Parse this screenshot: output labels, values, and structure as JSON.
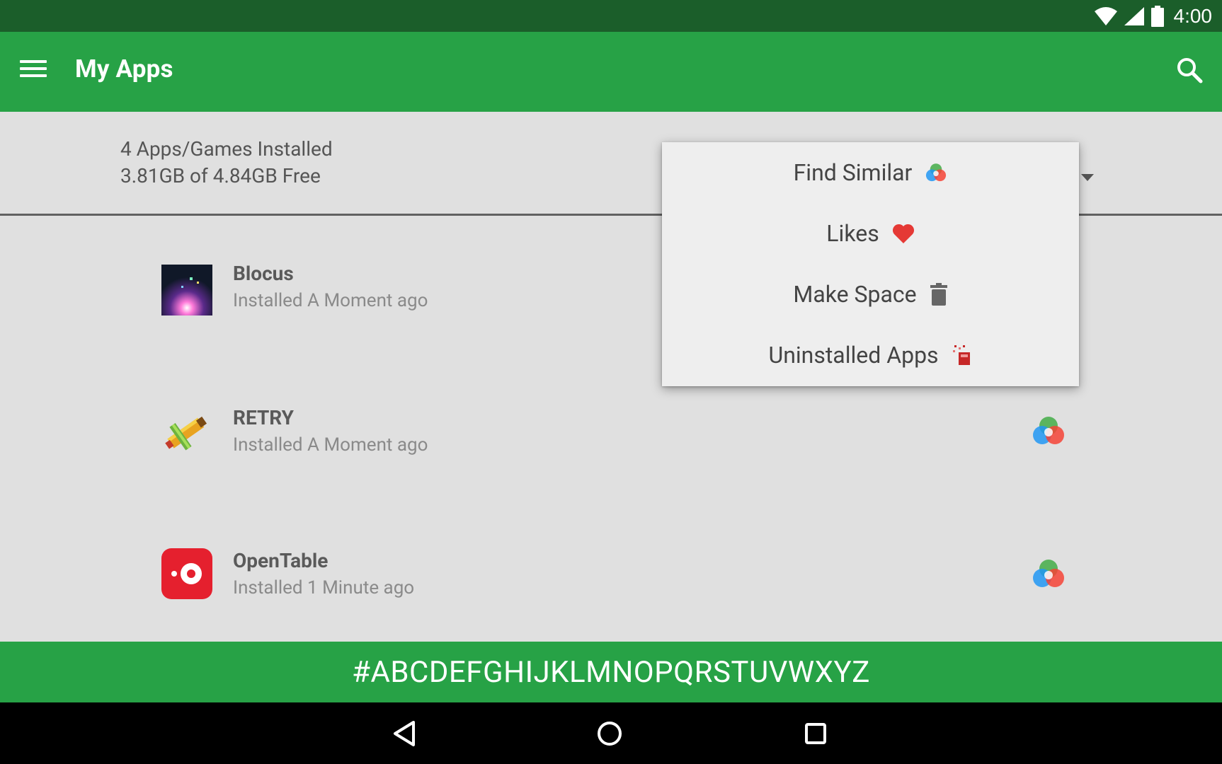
{
  "status_bar": {
    "time": "4:00"
  },
  "app_bar": {
    "title": "My Apps"
  },
  "summary": {
    "installed_count": "4 Apps/Games Installed",
    "storage": "3.81GB of 4.84GB Free"
  },
  "apps": [
    {
      "name": "Blocus",
      "installed": "Installed A Moment ago"
    },
    {
      "name": "RETRY",
      "installed": "Installed A Moment ago"
    },
    {
      "name": "OpenTable",
      "installed": "Installed 1 Minute ago"
    }
  ],
  "menu": {
    "items": [
      {
        "label": "Find Similar",
        "icon": "find-similar-icon"
      },
      {
        "label": "Likes",
        "icon": "heart-icon"
      },
      {
        "label": "Make Space",
        "icon": "trash-icon"
      },
      {
        "label": "Uninstalled Apps",
        "icon": "uninstalled-apps-icon"
      }
    ]
  },
  "alphabet_bar": {
    "letters": "#ABCDEFGHIJKLMNOPQRSTUVWXYZ"
  },
  "colors": {
    "status_bar": "#1b5e2a",
    "app_bar": "#27a246",
    "background": "#e0e0e0",
    "menu_background": "#eeeeee",
    "heart": "#e53935",
    "opentable_red": "#e5202e"
  }
}
